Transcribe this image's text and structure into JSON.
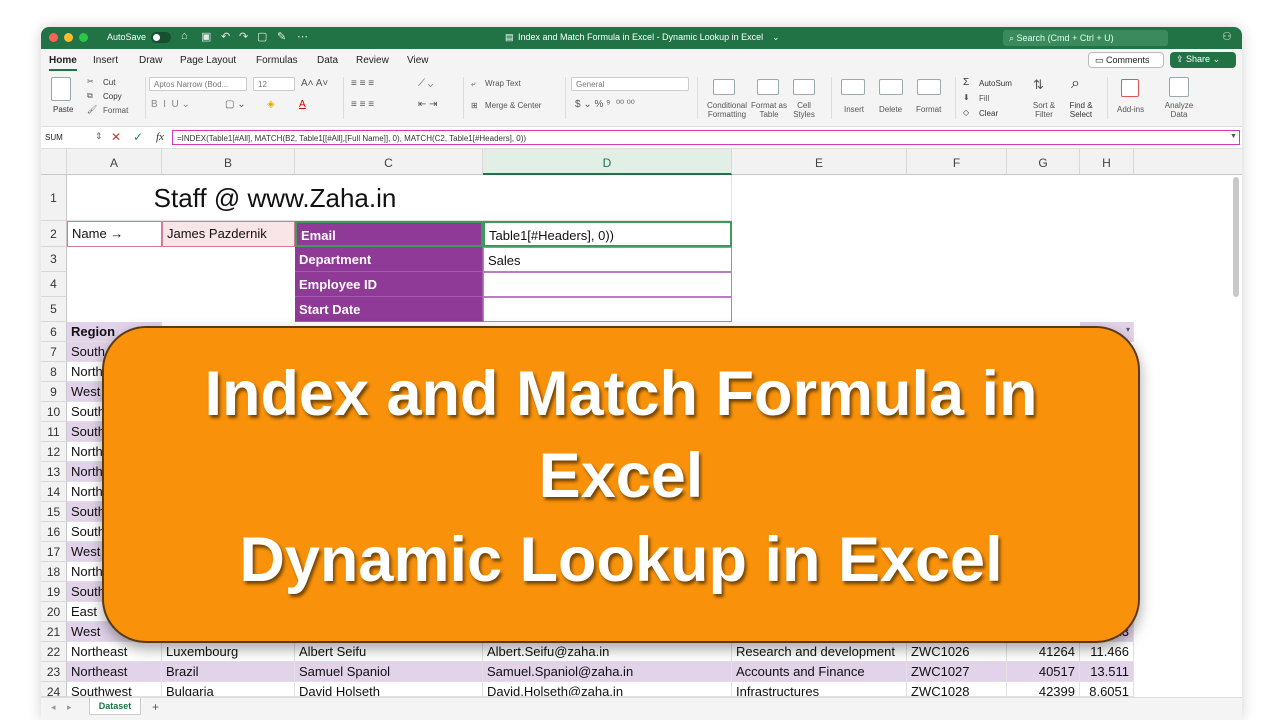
{
  "window": {
    "autosave_label": "AutoSave",
    "title": "Index and Match Formula in Excel - Dynamic Lookup in Excel",
    "search_placeholder": "Search (Cmd + Ctrl + U)"
  },
  "ribbon_tabs": [
    "Home",
    "Insert",
    "Draw",
    "Page Layout",
    "Formulas",
    "Data",
    "Review",
    "View"
  ],
  "comments_label": "Comments",
  "share_label": "Share",
  "ribbon": {
    "paste": "Paste",
    "cut": "Cut",
    "copy": "Copy",
    "format": "Format",
    "font_name": "Aptos Narrow (Bod...",
    "font_size": "12",
    "wrap_text": "Wrap Text",
    "merge_center": "Merge & Center",
    "number_format": "General",
    "conditional_formatting": "Conditional Formatting",
    "format_as_table": "Format as Table",
    "cell_styles": "Cell Styles",
    "insert": "Insert",
    "delete": "Delete",
    "format_cells": "Format",
    "autosum": "AutoSum",
    "fill": "Fill",
    "clear": "Clear",
    "sort_filter": "Sort & Filter",
    "find_select": "Find & Select",
    "addins": "Add-ins",
    "analyze_data": "Analyze Data"
  },
  "formula_bar": {
    "name_box": "SUM",
    "formula": "=INDEX(Table1[#All], MATCH(B2, Table1[[#All],[Full Name]], 0), MATCH(C2, Table1[#Headers], 0))"
  },
  "columns": [
    "A",
    "B",
    "C",
    "D",
    "E",
    "F",
    "G",
    "H"
  ],
  "rows": [
    "1",
    "2",
    "3",
    "4",
    "5",
    "6",
    "7",
    "8",
    "9",
    "10",
    "11",
    "12",
    "13",
    "14",
    "15",
    "16",
    "17",
    "18",
    "19",
    "20",
    "21",
    "22",
    "23",
    "24"
  ],
  "cells": {
    "title": "Staff @ www.Zaha.in",
    "name_label": "Name →",
    "name_value": "James Pazdernik",
    "email": "Email",
    "email_formula_tail": "Table1[#Headers], 0))",
    "department": "Department",
    "department_value": "Sales",
    "employee_id": "Employee ID",
    "start_date": "Start Date",
    "region_header": "Region"
  },
  "region_col": [
    "South",
    "North",
    "West",
    "South",
    "South",
    "North",
    "North",
    "North",
    "South",
    "South",
    "West",
    "North",
    "South",
    "East",
    "West"
  ],
  "table_rows": [
    {
      "region": "Northeast",
      "country": "Luxembourg",
      "name": "Albert Seifu",
      "email": "Albert.Seifu@zaha.in",
      "dept": "Research and development",
      "id": "ZWC1026",
      "num": "41264",
      "val": "11.466"
    },
    {
      "region": "Northeast",
      "country": "Brazil",
      "name": "Samuel Spaniol",
      "email": "Samuel.Spaniol@zaha.in",
      "dept": "Accounts and Finance",
      "id": "ZWC1027",
      "num": "40517",
      "val": "13.511"
    },
    {
      "region": "Southwest",
      "country": "Bulgaria",
      "name": "David Holseth",
      "email": "David.Holseth@zaha.in",
      "dept": "Infrastructures",
      "id": "ZWC1028",
      "num": "42399",
      "val": "8.6051"
    }
  ],
  "row21_h": "023",
  "sheet_tab": "Dataset",
  "banner": {
    "line1": "Index and Match Formula in",
    "line2": "Excel",
    "line3": "Dynamic Lookup in Excel"
  },
  "colors": {
    "excel_green": "#217346",
    "table_purple": "#8e3a96",
    "table_lavender": "#e2d2ea",
    "banner_orange": "#f9920a"
  }
}
